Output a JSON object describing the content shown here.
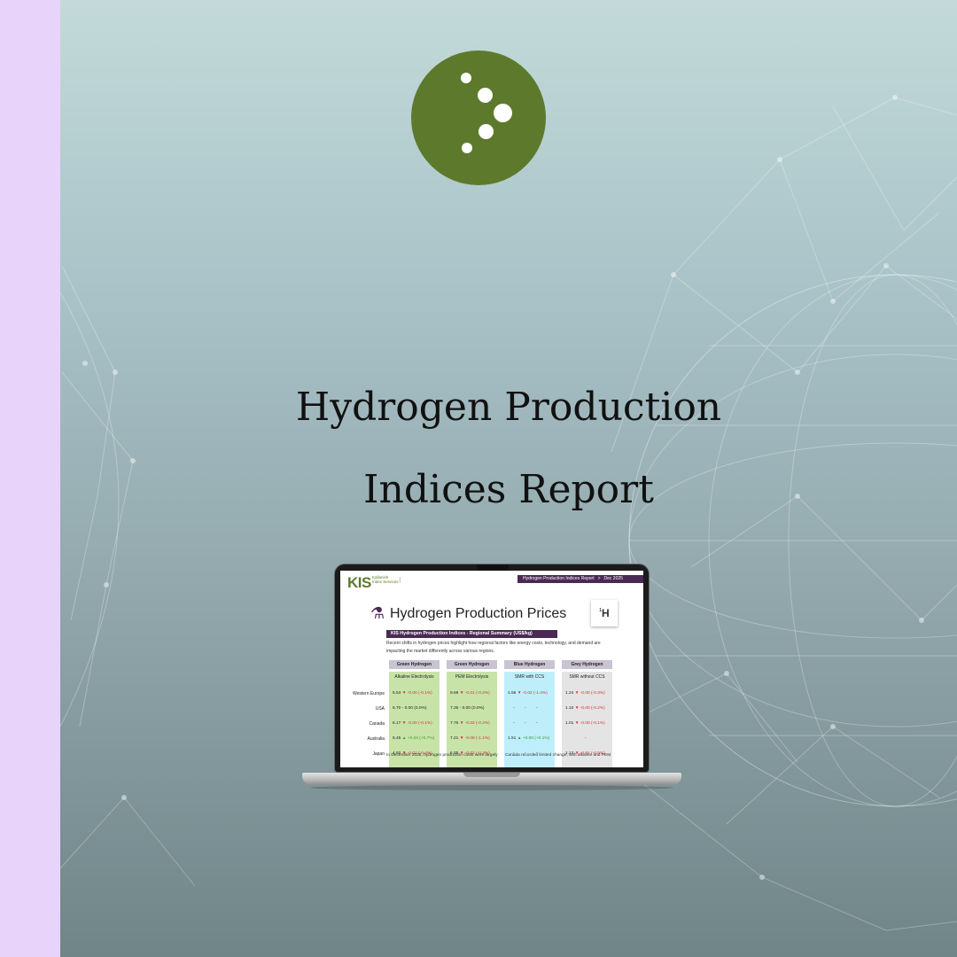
{
  "title": {
    "line1": "Hydrogen Production",
    "line2": "Indices Report"
  },
  "colors": {
    "left_strip": "#e8d3fb",
    "logo_green": "#5d7a2c",
    "report_purple": "#4a2a55",
    "green_col": "#c8e3a8",
    "blue_col": "#bfeefb",
    "grey_col": "#e4e4e4"
  },
  "logo": {
    "icon": "kis-dots-logo-icon"
  },
  "report": {
    "brand": "KIS",
    "brand_sub": "Kallanish Index Services",
    "header_title": "Hydrogen Production Indices Report",
    "header_separator": ">",
    "header_date": "Dec 2025",
    "doc_title": "Hydrogen Production Prices",
    "doc_icon": "hydrogen-electrolyser-icon",
    "badge_letter": "H",
    "badge_number": "1",
    "subtitle": "KIS Hydrogen Production Indices - Regional Summary (US$/kg)",
    "intro": "Recent shifts in hydrogen prices highlight how regional factors like energy costs, technology, and demand are impacting the market differently across various regions.",
    "columns": [
      {
        "group": "Green Hydrogen",
        "method": "Alkaline Electrolysis",
        "color": "#c8e3a8"
      },
      {
        "group": "Green Hydrogen",
        "method": "PEM Electrolysis",
        "color": "#c8e3a8"
      },
      {
        "group": "Blue Hydrogen",
        "method": "SMR with CCS",
        "color": "#bfeefb"
      },
      {
        "group": "Grey Hydrogen",
        "method": "SMR without CCS",
        "color": "#e4e4e4"
      }
    ],
    "rows": [
      {
        "region": "Western Europe",
        "cells": [
          {
            "value": "5.53",
            "arrow": "▼",
            "change": "-0.00 (-0.1%)",
            "dir": "down"
          },
          {
            "value": "8.69",
            "arrow": "▼",
            "change": "-0.01 (-0.2%)",
            "dir": "down"
          },
          {
            "value": "1.55",
            "arrow": "▼",
            "change": "-0.02 (-1.4%)",
            "dir": "down"
          },
          {
            "value": "1.24",
            "arrow": "▼",
            "change": "-0.00 (-0.3%)",
            "dir": "down"
          }
        ]
      },
      {
        "region": "USA",
        "cells": [
          {
            "value": "5.70",
            "arrow": "-",
            "change": "0.00 (0.0%)",
            "dir": "flat"
          },
          {
            "value": "7.35",
            "arrow": "-",
            "change": "0.00 (0.0%)",
            "dir": "flat"
          },
          {
            "value": "-",
            "arrow": "-",
            "change": "-",
            "dir": "flat"
          },
          {
            "value": "1.10",
            "arrow": "▼",
            "change": "-0.00 (-0.2%)",
            "dir": "down"
          }
        ]
      },
      {
        "region": "Canada",
        "cells": [
          {
            "value": "6.17",
            "arrow": "▼",
            "change": "-0.00 (-0.1%)",
            "dir": "down"
          },
          {
            "value": "7.76",
            "arrow": "▼",
            "change": "-0.02 (-0.2%)",
            "dir": "down"
          },
          {
            "value": "-",
            "arrow": "-",
            "change": "-",
            "dir": "flat"
          },
          {
            "value": "1.01",
            "arrow": "▼",
            "change": "-0.00 (-0.1%)",
            "dir": "down"
          }
        ]
      },
      {
        "region": "Australia",
        "cells": [
          {
            "value": "5.45",
            "arrow": "▲",
            "change": "+0.04 (+0.7%)",
            "dir": "up"
          },
          {
            "value": "7.21",
            "arrow": "▼",
            "change": "-0.08 (-1.1%)",
            "dir": "down"
          },
          {
            "value": "1.51",
            "arrow": "▲",
            "change": "+0.00 (+0.1%)",
            "dir": "up"
          },
          {
            "value": "-",
            "arrow": "",
            "change": "",
            "dir": "flat"
          }
        ]
      },
      {
        "region": "Japan",
        "cells": [
          {
            "value": "4.92",
            "arrow": "▼",
            "change": "-0.02 (-0.4%)",
            "dir": "down"
          },
          {
            "value": "6.00",
            "arrow": "▼",
            "change": "-0.02 (-0.3%)",
            "dir": "down"
          },
          {
            "value": "-",
            "arrow": "-",
            "change": "-",
            "dir": "flat"
          },
          {
            "value": "1.12",
            "arrow": "▼",
            "change": "-0.01 (-0.5%)",
            "dir": "down"
          }
        ]
      }
    ],
    "bottom_left": "In December 2025, hydrogen production costs were largely",
    "bottom_right": "Canada recorded limited change, with alkaline and PEM"
  }
}
